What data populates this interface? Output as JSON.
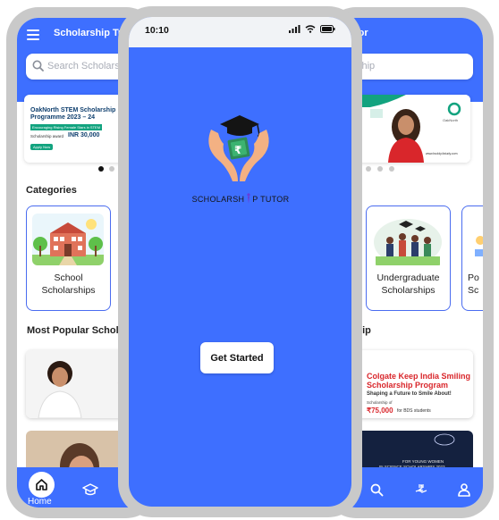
{
  "left_phone": {
    "app_title": "Scholarship Tut",
    "search_placeholder": "Search Scholars",
    "banner": {
      "title_line1": "OakNorth STEM Scholarship",
      "title_line2": "Programme 2023 – 24",
      "tagline": "Encouraging Rising Female Stars in STEM",
      "award_label": "Scholarship award",
      "award_value": "INR 30,000",
      "cta": "Apply Now"
    },
    "categories_title": "Categories",
    "category": {
      "line1": "School",
      "line2": "Scholarships"
    },
    "popular_title": "Most Popular Schola",
    "nav_home_label": "Home"
  },
  "right_phone": {
    "app_title": "tor",
    "search_placeholder": "ship",
    "banner_logo_text": "OakNorth",
    "banner_apply_text": "www.buddy4study.com",
    "category1": {
      "line1": "Undergraduate",
      "line2": "Scholarships"
    },
    "category2": {
      "line1": "Po",
      "line2": "Sc"
    },
    "popular_title": "rship",
    "card": {
      "title_line1": "Colgate Keep India Smiling",
      "title_line2": "Scholarship Program",
      "subtitle": "Shaping a Future to Smile About!",
      "amount_label": "Scholarship of",
      "amount_value": "₹75,000",
      "amount_note": "for BDS students"
    },
    "card2": {
      "line1": "FOR YOUNG WOMEN",
      "line2": "IN SCIENCE SCHOLARSHIPS 2023"
    }
  },
  "front_phone": {
    "time": "10:10",
    "logo_text_left": "SCHOLARSH",
    "logo_text_right": "P TUTOR",
    "get_started": "Get Started"
  },
  "colors": {
    "primary": "#3e6fff",
    "green": "#12a37f",
    "red": "#d9262b",
    "shell": "#c9c9c9"
  }
}
